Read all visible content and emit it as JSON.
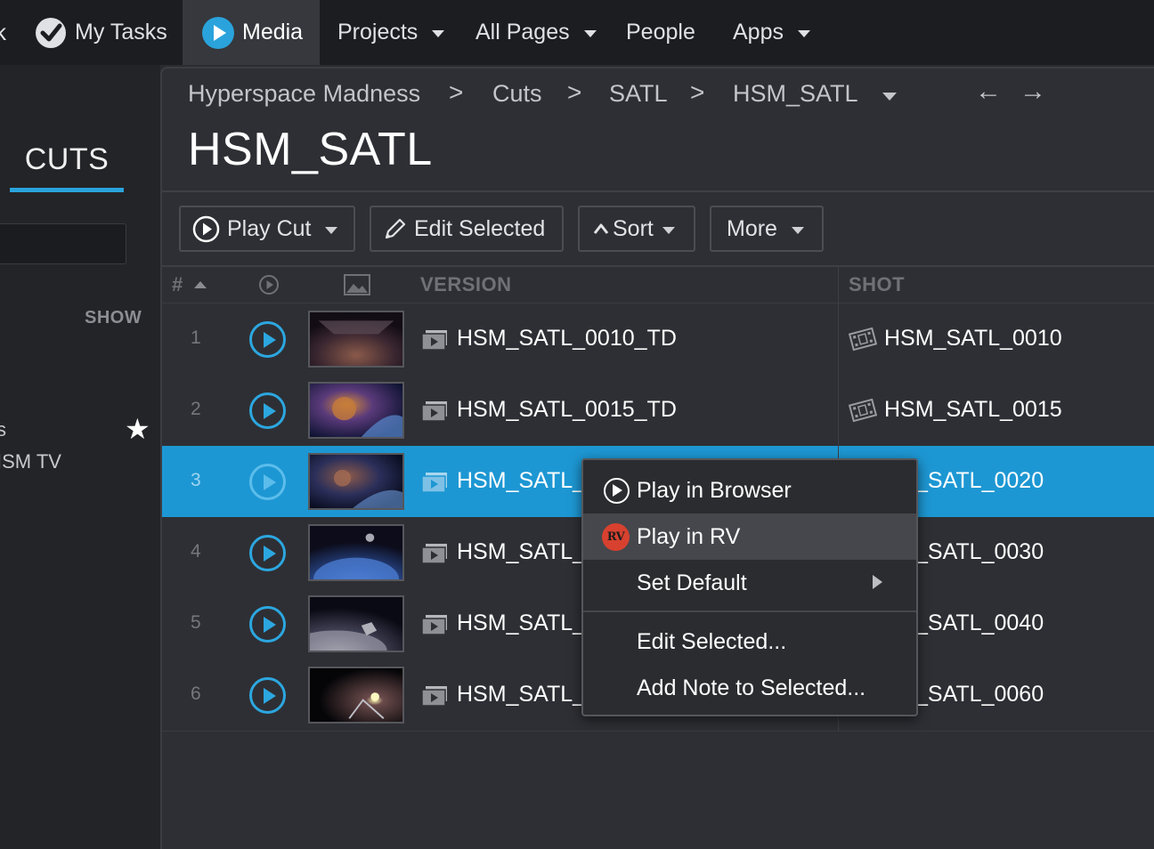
{
  "nav": {
    "items": [
      {
        "label": "My Tasks"
      },
      {
        "label": "Media"
      },
      {
        "label": "Projects"
      },
      {
        "label": "All Pages"
      },
      {
        "label": "People"
      },
      {
        "label": "Apps"
      }
    ],
    "accent": "#2aa3dc"
  },
  "sidebar": {
    "tab": "CUTS",
    "section_label": "SHOW",
    "item_fragment": "s",
    "project_fragment": "ISM TV"
  },
  "breadcrumb": [
    "Hyperspace Madness",
    "Cuts",
    "SATL",
    "HSM_SATL"
  ],
  "breadcrumb_separator": ">",
  "nav_arrows": {
    "back": "←",
    "forward": "→"
  },
  "page_title": "HSM_SATL",
  "toolbar": {
    "play_cut": "Play Cut",
    "edit_selected": "Edit Selected",
    "sort": "Sort",
    "more": "More"
  },
  "table": {
    "headers": {
      "num": "#",
      "version": "VERSION",
      "shot": "SHOT"
    },
    "rows": [
      {
        "num": "1",
        "version": "HSM_SATL_0010_TD",
        "shot": "HSM_SATL_0010"
      },
      {
        "num": "2",
        "version": "HSM_SATL_0015_TD",
        "shot": "HSM_SATL_0015"
      },
      {
        "num": "3",
        "version": "HSM_SATL_",
        "shot": "_SATL_0020",
        "selected": true
      },
      {
        "num": "4",
        "version": "HSM_SATL_",
        "shot": "_SATL_0030"
      },
      {
        "num": "5",
        "version": "HSM_SATL_",
        "shot": "_SATL_0040"
      },
      {
        "num": "6",
        "version": "HSM_SATL_",
        "shot": "_SATL_0060"
      }
    ],
    "selected_color": "#1d97d3"
  },
  "context_menu": {
    "play_in_browser": "Play in Browser",
    "play_in_rv": "Play in RV",
    "rv_badge": "RV",
    "set_default": "Set Default",
    "edit_selected": "Edit Selected...",
    "add_note": "Add Note to Selected..."
  }
}
